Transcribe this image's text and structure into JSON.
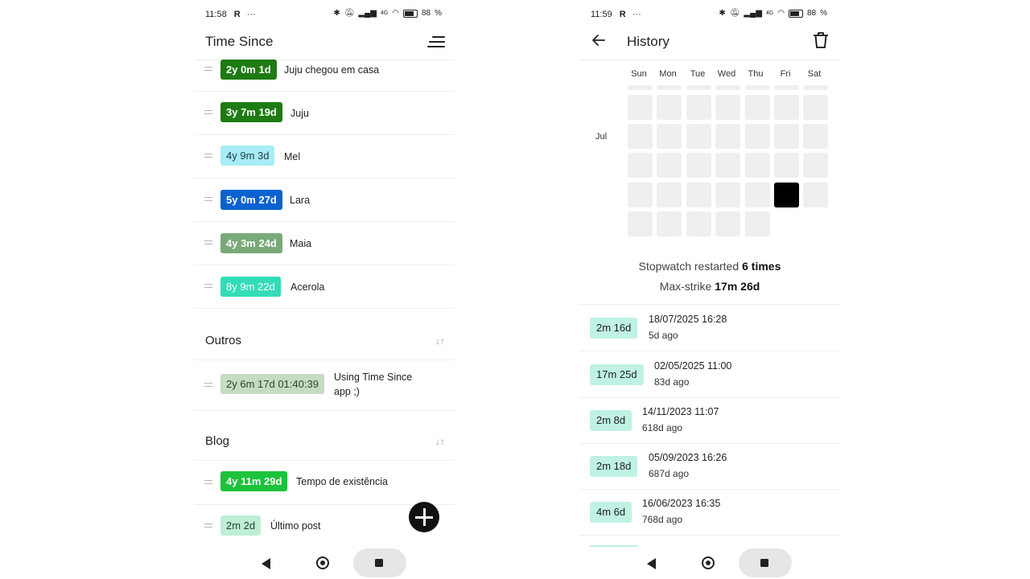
{
  "left_screen": {
    "status": {
      "time": "11:58",
      "carrier_icon": "R",
      "more": "···",
      "network": "4G",
      "battery": "88"
    },
    "title": "Time Since",
    "main_items": [
      {
        "badge": "2y 0m 1d",
        "label": "Juju chegou em casa",
        "bg": "#1e7b12",
        "fg": "#ffffff"
      },
      {
        "badge": "3y 7m 19d",
        "label": "Juju",
        "bg": "#1e7b12",
        "fg": "#ffffff"
      },
      {
        "badge": "4y 9m 3d",
        "label": "Mel",
        "bg": "#a7ecf6",
        "fg": "#1c3a44"
      },
      {
        "badge": "5y 0m 27d",
        "label": "Lara",
        "bg": "#0a62d0",
        "fg": "#ffffff"
      },
      {
        "badge": "4y 3m 24d",
        "label": "Maia",
        "bg": "#7aa97a",
        "fg": "#ffffff"
      },
      {
        "badge": "8y 9m 22d",
        "label": "Acerola",
        "bg": "#33dcb8",
        "fg": "#ffffff"
      }
    ],
    "sections": [
      {
        "title": "Outros",
        "items": [
          {
            "badge": "2y 6m 17d 01:40:39",
            "label_line1": "Using Time Since",
            "label_line2": "app ;)",
            "bg": "#c4dcc0",
            "fg": "#33402f"
          }
        ]
      },
      {
        "title": "Blog",
        "items": [
          {
            "badge": "4y 11m 29d",
            "label": "Tempo de existência",
            "bg": "#1cc33a",
            "fg": "#ffffff"
          },
          {
            "badge": "2m 2d",
            "label": "Último post",
            "bg": "#bfeed6",
            "fg": "#1f3f2f"
          }
        ]
      }
    ]
  },
  "right_screen": {
    "status": {
      "time": "11:59",
      "carrier_icon": "R",
      "more": "···",
      "network": "4G",
      "battery": "88"
    },
    "title": "History",
    "weekdays": [
      "Sun",
      "Mon",
      "Tue",
      "Wed",
      "Thu",
      "Fri",
      "Sat"
    ],
    "month_label": "Jul",
    "calendar_active": {
      "week": 4,
      "day": "Fri"
    },
    "stats": {
      "restarted_label": "Stopwatch restarted",
      "restarted_value": "6 times",
      "maxstrike_label": "Max-strike",
      "maxstrike_value": "17m 26d"
    },
    "history": [
      {
        "duration": "2m 16d",
        "datetime": "18/07/2025 16:28",
        "ago": "5d ago"
      },
      {
        "duration": "17m 25d",
        "datetime": "02/05/2025 11:00",
        "ago": "83d ago"
      },
      {
        "duration": "2m 8d",
        "datetime": "14/11/2023 11:07",
        "ago": "618d ago"
      },
      {
        "duration": "2m 18d",
        "datetime": "05/09/2023 16:26",
        "ago": "687d ago"
      },
      {
        "duration": "4m 6d",
        "datetime": "16/06/2023 16:35",
        "ago": "768d ago"
      }
    ]
  }
}
